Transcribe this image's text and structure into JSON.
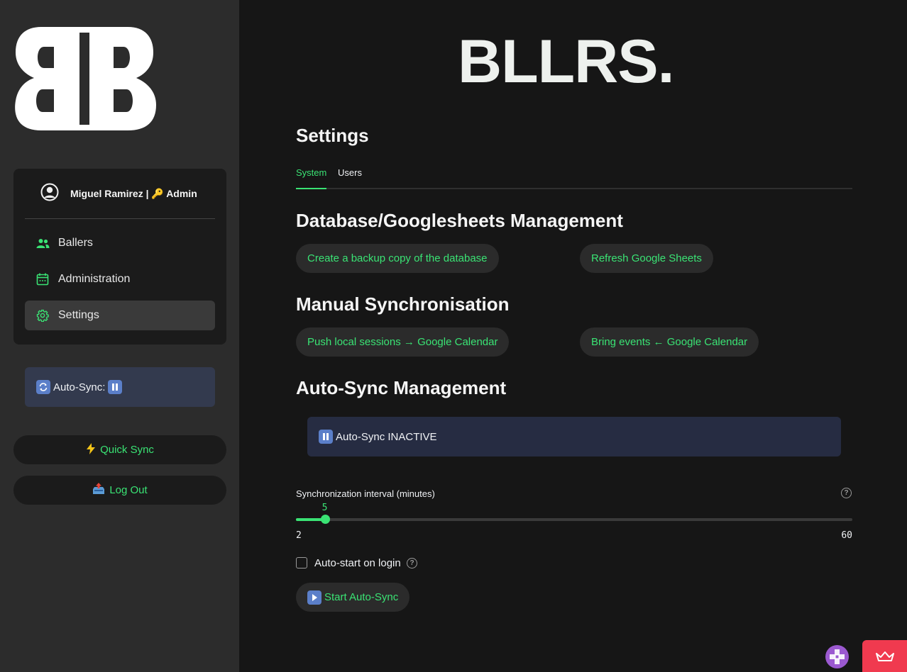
{
  "sidebar": {
    "user": {
      "name": "Miguel Ramirez | 🔑 Admin"
    },
    "nav": [
      {
        "label": "Ballers",
        "icon": "users-icon",
        "active": false
      },
      {
        "label": "Administration",
        "icon": "calendar-icon",
        "active": false
      },
      {
        "label": "Settings",
        "icon": "gear-icon",
        "active": true
      }
    ],
    "autosync_status": "Auto-Sync:",
    "quick_sync": "Quick Sync",
    "log_out": "Log Out"
  },
  "header": {
    "brand": "BLLRS."
  },
  "main": {
    "title": "Settings",
    "tabs": [
      {
        "label": "System",
        "active": true
      },
      {
        "label": "Users",
        "active": false
      }
    ],
    "sections": {
      "database": {
        "heading": "Database/Googlesheets Management",
        "backup_button": "Create a backup copy of the database",
        "refresh_button": "Refresh Google Sheets"
      },
      "manual_sync": {
        "heading": "Manual Synchronisation",
        "push_button": "Push local sessions → Google Calendar",
        "bring_button": "Bring events ← Google Calendar"
      },
      "autosync": {
        "heading": "Auto-Sync Management",
        "status": "Auto-Sync INACTIVE",
        "interval_label": "Synchronization interval (minutes)",
        "interval_value": 5,
        "interval_min": 2,
        "interval_max": 60,
        "autostart_label": "Auto-start on login",
        "autostart_checked": false,
        "start_button": "Start Auto-Sync"
      }
    }
  },
  "colors": {
    "accent": "#3ae374",
    "sidebar_bg": "#2c2c2c",
    "main_bg": "#161616",
    "info_box": "#262c42",
    "corner_badge": "#f03a4f"
  }
}
